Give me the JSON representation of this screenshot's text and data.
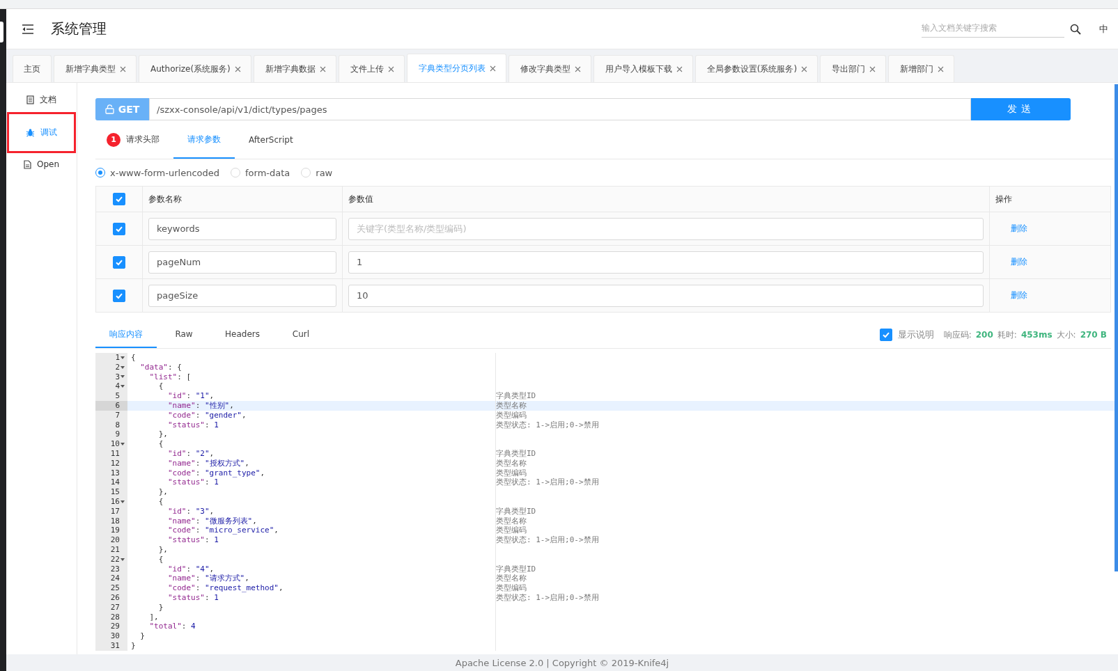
{
  "header": {
    "title": "系统管理",
    "search": {
      "placeholder": "输入文档关键字搜索"
    },
    "language": "中"
  },
  "tabs": [
    {
      "label": "主页",
      "closable": false,
      "selected": false
    },
    {
      "label": "新增字典类型",
      "closable": true,
      "selected": false
    },
    {
      "label": "Authorize(系统服务)",
      "closable": true,
      "selected": false
    },
    {
      "label": "新增字典数据",
      "closable": true,
      "selected": false
    },
    {
      "label": "文件上传",
      "closable": true,
      "selected": false
    },
    {
      "label": "字典类型分页列表",
      "closable": true,
      "selected": true
    },
    {
      "label": "修改字典类型",
      "closable": true,
      "selected": false
    },
    {
      "label": "用户导入模板下载",
      "closable": true,
      "selected": false
    },
    {
      "label": "全局参数设置(系统服务)",
      "closable": true,
      "selected": false
    },
    {
      "label": "导出部门",
      "closable": true,
      "selected": false
    },
    {
      "label": "新增部门",
      "closable": true,
      "selected": false
    }
  ],
  "sidebar": {
    "items": [
      {
        "label": "文档",
        "selected": false,
        "highlighted": false
      },
      {
        "label": "调试",
        "selected": true,
        "highlighted": true
      },
      {
        "label": "Open",
        "selected": false,
        "highlighted": false
      }
    ]
  },
  "request": {
    "method": "GET",
    "url": "/szxx-console/api/v1/dict/types/pages",
    "send_label": "发送"
  },
  "request_tabs": [
    {
      "label": "请求头部",
      "badge": "1",
      "selected": false
    },
    {
      "label": "请求参数",
      "selected": true
    },
    {
      "label": "AfterScript",
      "selected": false
    }
  ],
  "content_types": [
    {
      "label": "x-www-form-urlencoded",
      "selected": true
    },
    {
      "label": "form-data",
      "selected": false
    },
    {
      "label": "raw",
      "selected": false
    }
  ],
  "params": {
    "all_checked": true,
    "columns": [
      "参数名称",
      "参数值",
      "操作"
    ],
    "rows": [
      {
        "checked": true,
        "name": "keywords",
        "placeholder": "关键字(类型名称/类型编码)",
        "action": "删除"
      },
      {
        "checked": true,
        "name": "pageNum",
        "value": "1",
        "action": "删除"
      },
      {
        "checked": true,
        "name": "pageSize",
        "value": "10",
        "action": "删除"
      }
    ]
  },
  "response_tabs": [
    {
      "label": "响应内容",
      "selected": true
    },
    {
      "label": "Raw",
      "selected": false
    },
    {
      "label": "Headers",
      "selected": false
    },
    {
      "label": "Curl",
      "selected": false
    }
  ],
  "response_meta": {
    "show_notes": true,
    "show_notes_label": "显示说明",
    "code_label": "响应码:",
    "code": "200",
    "time_label": "耗时:",
    "time": "453ms",
    "size_label": "大小:",
    "size": "270 B"
  },
  "code_lines": [
    {
      "number": "1",
      "text": "{",
      "foldable": true,
      "selected": false
    },
    {
      "number": "2",
      "text": "  \"data\": {",
      "foldable": true,
      "selected": false
    },
    {
      "number": "3",
      "text": "    \"list\": [",
      "foldable": true,
      "selected": false
    },
    {
      "number": "4",
      "text": "      {",
      "foldable": true,
      "selected": false
    },
    {
      "number": "5",
      "text": "        \"id\": \"1\",",
      "foldable": false,
      "selected": false,
      "note": "字典类型ID"
    },
    {
      "number": "6",
      "text": "        \"name\": \"性别\",",
      "foldable": false,
      "selected": true,
      "note": "类型名称"
    },
    {
      "number": "7",
      "text": "        \"code\": \"gender\",",
      "foldable": false,
      "selected": false,
      "note": "类型编码"
    },
    {
      "number": "8",
      "text": "        \"status\": 1",
      "foldable": false,
      "selected": false,
      "note": "类型状态: 1->启用;0->禁用"
    },
    {
      "number": "9",
      "text": "      },",
      "foldable": false,
      "selected": false
    },
    {
      "number": "10",
      "text": "      {",
      "foldable": true,
      "selected": false
    },
    {
      "number": "11",
      "text": "        \"id\": \"2\",",
      "foldable": false,
      "selected": false,
      "note": "字典类型ID"
    },
    {
      "number": "12",
      "text": "        \"name\": \"授权方式\",",
      "foldable": false,
      "selected": false,
      "note": "类型名称"
    },
    {
      "number": "13",
      "text": "        \"code\": \"grant_type\",",
      "foldable": false,
      "selected": false,
      "note": "类型编码"
    },
    {
      "number": "14",
      "text": "        \"status\": 1",
      "foldable": false,
      "selected": false,
      "note": "类型状态: 1->启用;0->禁用"
    },
    {
      "number": "15",
      "text": "      },",
      "foldable": false,
      "selected": false
    },
    {
      "number": "16",
      "text": "      {",
      "foldable": true,
      "selected": false
    },
    {
      "number": "17",
      "text": "        \"id\": \"3\",",
      "foldable": false,
      "selected": false,
      "note": "字典类型ID"
    },
    {
      "number": "18",
      "text": "        \"name\": \"微服务列表\",",
      "foldable": false,
      "selected": false,
      "note": "类型名称"
    },
    {
      "number": "19",
      "text": "        \"code\": \"micro_service\",",
      "foldable": false,
      "selected": false,
      "note": "类型编码"
    },
    {
      "number": "20",
      "text": "        \"status\": 1",
      "foldable": false,
      "selected": false,
      "note": "类型状态: 1->启用;0->禁用"
    },
    {
      "number": "21",
      "text": "      },",
      "foldable": false,
      "selected": false
    },
    {
      "number": "22",
      "text": "      {",
      "foldable": true,
      "selected": false
    },
    {
      "number": "23",
      "text": "        \"id\": \"4\",",
      "foldable": false,
      "selected": false,
      "note": "字典类型ID"
    },
    {
      "number": "24",
      "text": "        \"name\": \"请求方式\",",
      "foldable": false,
      "selected": false,
      "note": "类型名称"
    },
    {
      "number": "25",
      "text": "        \"code\": \"request_method\",",
      "foldable": false,
      "selected": false,
      "note": "类型编码"
    },
    {
      "number": "26",
      "text": "        \"status\": 1",
      "foldable": false,
      "selected": false,
      "note": "类型状态: 1->启用;0->禁用"
    },
    {
      "number": "27",
      "text": "      }",
      "foldable": false,
      "selected": false
    },
    {
      "number": "28",
      "text": "    ],",
      "foldable": false,
      "selected": false
    },
    {
      "number": "29",
      "text": "    \"total\": 4",
      "foldable": false,
      "selected": false
    },
    {
      "number": "30",
      "text": "  }",
      "foldable": false,
      "selected": false
    },
    {
      "number": "31",
      "text": "}",
      "foldable": false,
      "selected": false
    }
  ],
  "footer": "Apache License 2.0 | Copyright © 2019-Knife4j"
}
